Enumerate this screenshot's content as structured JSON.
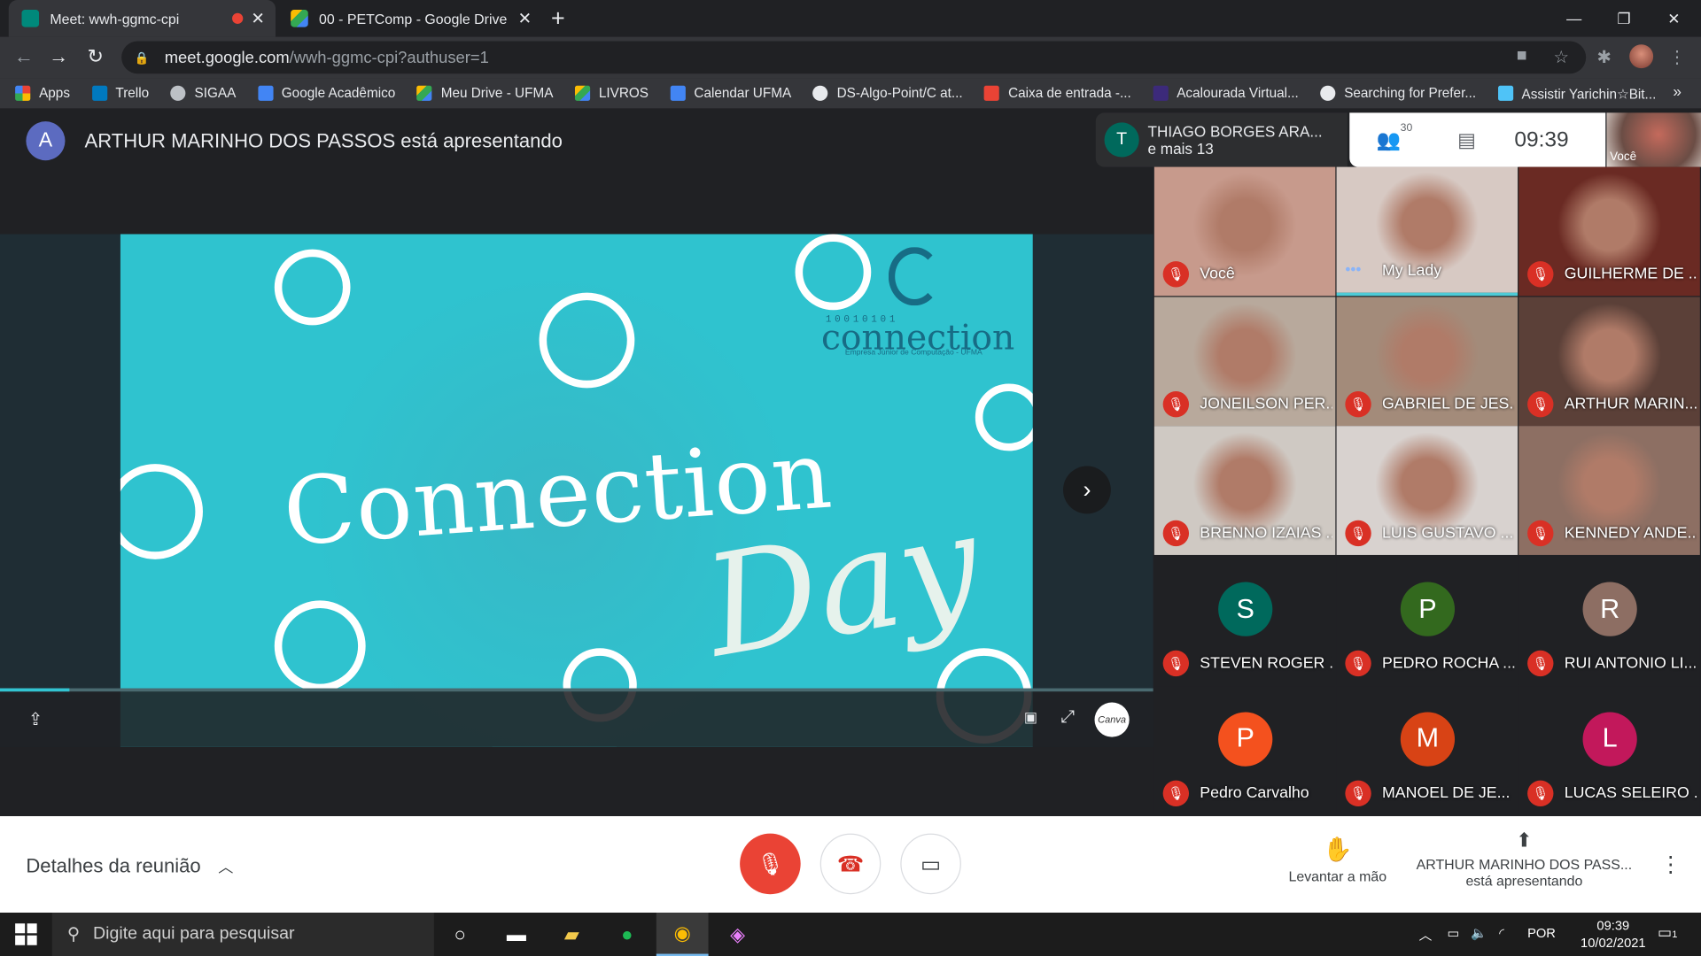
{
  "browser": {
    "tabs": [
      {
        "title": "Meet: wwh-ggmc-cpi",
        "active": true
      },
      {
        "title": "00 - PETComp - Google Drive",
        "active": false
      }
    ],
    "new_tab_icon": "plus-icon",
    "url_host": "meet.google.com",
    "url_path": "/wwh-ggmc-cpi?authuser=1",
    "bookmarks": [
      {
        "label": "Apps",
        "color": "#ea4335"
      },
      {
        "label": "Trello",
        "color": "#0079bf"
      },
      {
        "label": "SIGAA",
        "color": "#bdc1c6"
      },
      {
        "label": "Google Acadêmico",
        "color": "#4285f4"
      },
      {
        "label": "Meu Drive - UFMA",
        "color": "#34a853"
      },
      {
        "label": "LIVROS",
        "color": "#4285f4"
      },
      {
        "label": "Calendar UFMA",
        "color": "#4285f4"
      },
      {
        "label": "DS-Algo-Point/C at...",
        "color": "#e8eaed"
      },
      {
        "label": "Caixa de entrada -...",
        "color": "#ea4335"
      },
      {
        "label": "Acalourada Virtual...",
        "color": "#3c2a7a"
      },
      {
        "label": "Searching for Prefer...",
        "color": "#e8eaed"
      },
      {
        "label": "Assistir Yarichin☆Bit...",
        "color": "#4fc3f7"
      }
    ]
  },
  "meet": {
    "presenter_initial": "A",
    "presenter_text": "ARTHUR MARINHO DOS PASSOS está apresentando",
    "slide": {
      "title": "Connection",
      "subtitle": "Day",
      "logo_digits": "10010101",
      "logo_name": "connection",
      "logo_sub": "Empresa Júnior de Computação - UFMA",
      "progress": 0.06,
      "canva_label": "Canva"
    },
    "chip": {
      "initial": "T",
      "line1": "THIAGO BORGES ARA...",
      "line2": "e mais 13"
    },
    "participant_count": "30",
    "time": "09:39",
    "self_label": "Você",
    "participants": [
      {
        "name": "Você",
        "type": "video",
        "bg": "#c79a8c",
        "muted": true
      },
      {
        "name": "My Lady",
        "type": "video",
        "bg": "#d7c9c3",
        "muted": false,
        "speaking": true
      },
      {
        "name": "GUILHERME DE ...",
        "type": "video",
        "bg": "#6a2a23",
        "muted": true
      },
      {
        "name": "JONEILSON PER...",
        "type": "video",
        "bg": "#b8a99c",
        "muted": true
      },
      {
        "name": "GABRIEL DE JES...",
        "type": "video",
        "bg": "#a38b7a",
        "muted": true
      },
      {
        "name": "ARTHUR MARIN...",
        "type": "video",
        "bg": "#5b4038",
        "muted": true
      },
      {
        "name": "BRENNO IZAIAS ...",
        "type": "video",
        "bg": "#cfc9c3",
        "muted": true
      },
      {
        "name": "LUIS GUSTAVO ...",
        "type": "video",
        "bg": "#d8d2cf",
        "muted": true
      },
      {
        "name": "KENNEDY ANDE...",
        "type": "video",
        "bg": "#8d6f63",
        "muted": true
      },
      {
        "name": "STEVEN ROGER ...",
        "type": "avatar",
        "initial": "S",
        "color": "#00695c",
        "muted": true
      },
      {
        "name": "PEDRO ROCHA ...",
        "type": "avatar",
        "initial": "P",
        "color": "#33691e",
        "muted": true
      },
      {
        "name": "RUI ANTONIO LI...",
        "type": "avatar",
        "initial": "R",
        "color": "#8d6e63",
        "muted": true
      },
      {
        "name": "Pedro Carvalho",
        "type": "avatar",
        "initial": "P",
        "color": "#f4511e",
        "muted": true
      },
      {
        "name": "MANOEL DE JE...",
        "type": "avatar",
        "initial": "M",
        "color": "#d84315",
        "muted": true
      },
      {
        "name": "LUCAS SELEIRO ...",
        "type": "avatar",
        "initial": "L",
        "color": "#c2185b",
        "muted": true
      }
    ]
  },
  "bottom": {
    "details": "Detalhes da reunião",
    "raise_hand": "Levantar a mão",
    "presenting_name": "ARTHUR MARINHO DOS PASS...",
    "presenting_sub": "está apresentando"
  },
  "taskbar": {
    "search_placeholder": "Digite aqui para pesquisar",
    "lang": "POR",
    "time": "09:39",
    "date": "10/02/2021",
    "notification_count": "1"
  }
}
